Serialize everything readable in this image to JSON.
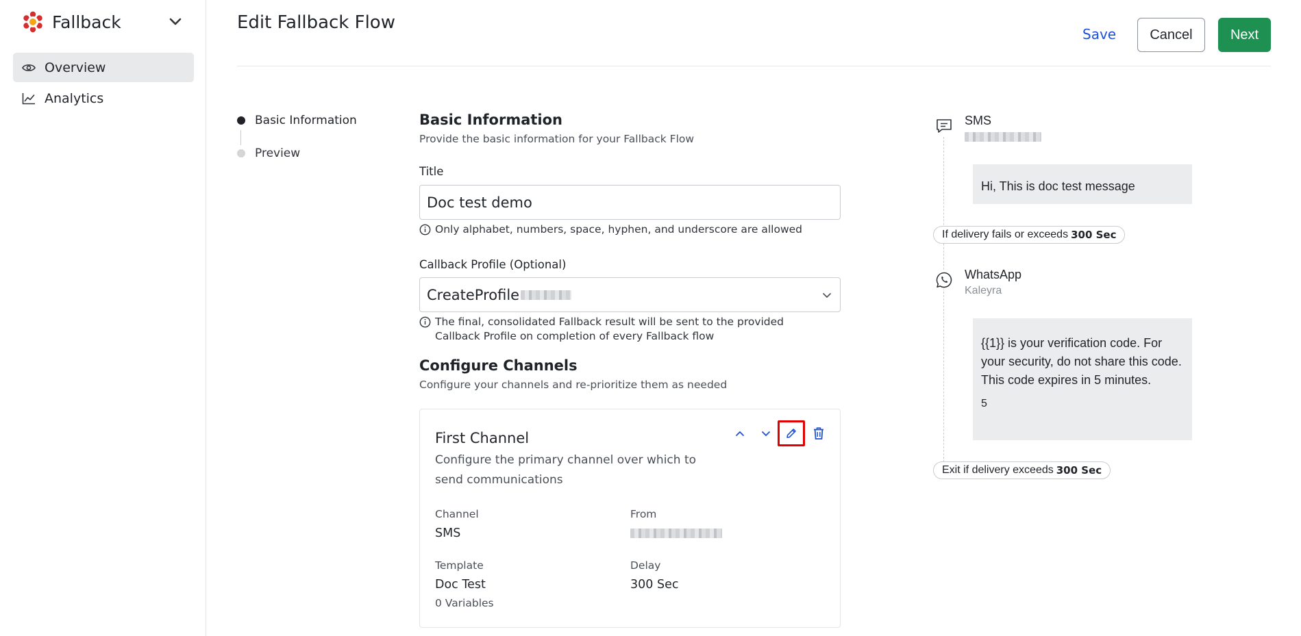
{
  "app": {
    "name": "Fallback"
  },
  "sidebar": {
    "items": [
      {
        "label": "Overview",
        "icon": "eye-icon",
        "active": true
      },
      {
        "label": "Analytics",
        "icon": "chart-line-icon",
        "active": false
      }
    ]
  },
  "header": {
    "title": "Edit Fallback Flow",
    "save_label": "Save",
    "cancel_label": "Cancel",
    "next_label": "Next"
  },
  "steps": [
    {
      "label": "Basic Information",
      "active": true
    },
    {
      "label": "Preview",
      "active": false
    }
  ],
  "basic_info": {
    "title": "Basic Information",
    "description": "Provide the basic information for your Fallback Flow",
    "title_field": {
      "label": "Title",
      "value": "Doc test demo",
      "hint": "Only alphabet, numbers, space, hyphen, and underscore are allowed"
    },
    "callback_field": {
      "label": "Callback Profile (Optional)",
      "value": "CreateProfile",
      "hint_line1": "The final, consolidated Fallback result will be sent to the provided",
      "hint_line2": "Callback Profile on completion of every Fallback flow"
    }
  },
  "channels": {
    "title": "Configure Channels",
    "description": "Configure your channels and re-prioritize them as needed",
    "first": {
      "title": "First Channel",
      "description": "Configure the primary channel over which to send communications",
      "channel_label": "Channel",
      "channel_value": "SMS",
      "from_label": "From",
      "template_label": "Template",
      "template_value": "Doc Test",
      "template_vars": "0 Variables",
      "delay_label": "Delay",
      "delay_value": "300 Sec"
    }
  },
  "preview": {
    "sms": {
      "name": "SMS",
      "message": "Hi, This is doc test message"
    },
    "condition": {
      "text": "If delivery fails or exceeds",
      "value": "300 Sec"
    },
    "whatsapp": {
      "name": "WhatsApp",
      "provider": "Kaleyra",
      "message": "{{1}} is your verification code. For your security, do not share this code. This code expires in 5 minutes.",
      "footer": "5"
    },
    "exit": {
      "text": "Exit if delivery exceeds",
      "value": "300 Sec"
    }
  },
  "colors": {
    "primary_link": "#1e50d6",
    "next_button": "#1e9152",
    "highlight_box": "#e00000",
    "logo": "#d32f2f"
  }
}
